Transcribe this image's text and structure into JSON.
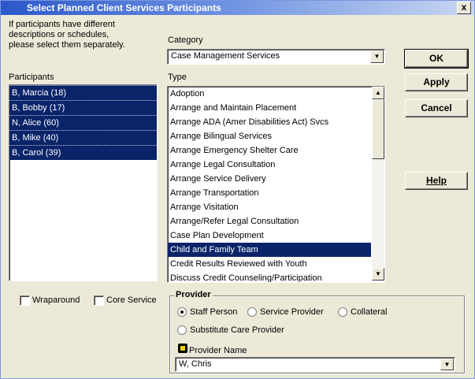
{
  "window": {
    "title": "Select Planned Client Services Participants",
    "close_label": "x"
  },
  "instructions": "If participants have different\ndescriptions or schedules,\nplease select them separately.",
  "participants": {
    "label": "Participants",
    "items": [
      "B, Marcia (18)",
      "B, Bobby (17)",
      "N, Alice (60)",
      "B, Mike (40)",
      "B, Carol (39)"
    ]
  },
  "category": {
    "label": "Category",
    "value": "Case Management Services"
  },
  "type": {
    "label": "Type",
    "items": [
      "Adoption",
      "Arrange and Maintain Placement",
      "Arrange ADA (Amer Disabilities Act) Svcs",
      "Arrange Bilingual Services",
      "Arrange Emergency Shelter Care",
      "Arrange Legal Consultation",
      "Arrange Service Delivery",
      "Arrange Transportation",
      "Arrange Visitation",
      "Arrange/Refer Legal Consultation",
      "Case Plan Development",
      "Child and Family Team",
      "Credit Results Reviewed with Youth",
      "Discuss Credit Counseling/Participation"
    ],
    "selected": "Child and Family Team"
  },
  "buttons": {
    "ok": "OK",
    "apply": "Apply",
    "cancel": "Cancel",
    "help": "Help"
  },
  "checkboxes": {
    "wraparound": "Wraparound",
    "core_service": "Core Service"
  },
  "provider": {
    "legend": "Provider",
    "options": {
      "staff": "Staff Person",
      "service_provider": "Service Provider",
      "collateral": "Collateral",
      "substitute": "Substitute Care Provider"
    },
    "selected": "Staff Person",
    "name_label": "Provider Name",
    "name_value": "W, Chris"
  }
}
